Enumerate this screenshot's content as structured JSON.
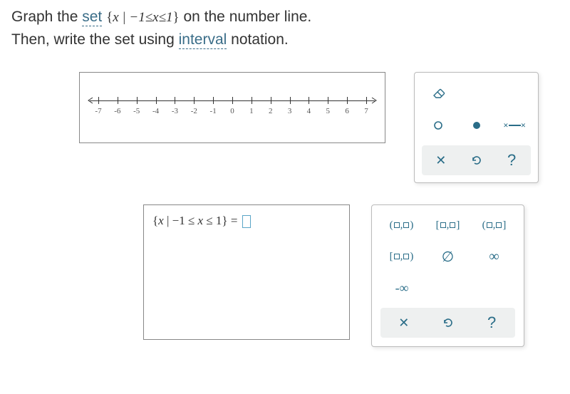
{
  "question": {
    "line1_pre": "Graph the ",
    "set_word": "set",
    "set_expr": "{x | −1≤x≤1}",
    "line1_post": " on the number line.",
    "line2_pre": "Then, write the set using ",
    "interval_word": "interval",
    "line2_post": " notation."
  },
  "numberline": {
    "ticks": [
      "-7",
      "-6",
      "-5",
      "-4",
      "-3",
      "-2",
      "-1",
      "0",
      "1",
      "2",
      "3",
      "4",
      "5",
      "6",
      "7"
    ]
  },
  "graph_tools": {
    "eraser": "eraser-icon",
    "open_point": "○",
    "closed_point": "●",
    "segment": "segment",
    "clear": "✕",
    "reset": "↺",
    "help": "?"
  },
  "answer": {
    "expr_prefix": "{x | −1 ≤ x ≤ 1} = "
  },
  "interval_tools": {
    "row1": [
      "(□,□)",
      "[□,□]",
      "(□,□]"
    ],
    "row2": [
      "[□,□)",
      "∅",
      "∞"
    ],
    "row3": [
      "-∞"
    ],
    "clear": "✕",
    "reset": "↺",
    "help": "?"
  },
  "chart_data": {
    "type": "numberline",
    "range": [
      -7,
      7
    ],
    "ticks": [
      -7,
      -6,
      -5,
      -4,
      -3,
      -2,
      -1,
      0,
      1,
      2,
      3,
      4,
      5,
      6,
      7
    ],
    "highlighted_interval": null,
    "target_interval": {
      "low": -1,
      "high": 1,
      "low_closed": true,
      "high_closed": true
    }
  }
}
